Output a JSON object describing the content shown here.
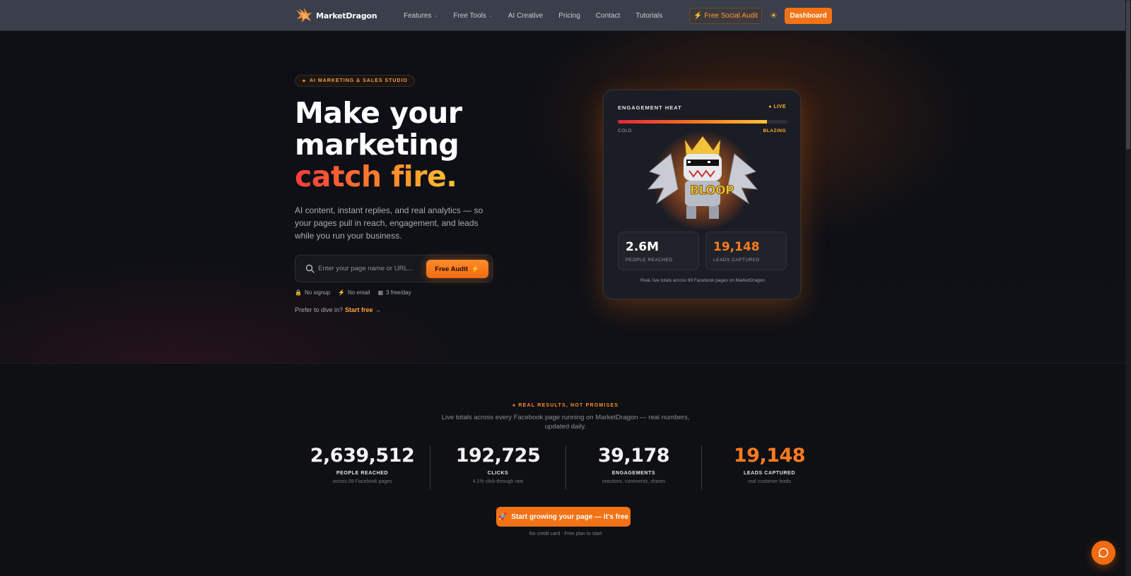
{
  "nav": {
    "brand": "MarketDragon",
    "links": [
      {
        "label": "Features",
        "dropdown": true
      },
      {
        "label": "Free Tools",
        "dropdown": true
      },
      {
        "label": "AI Creative",
        "dropdown": false
      },
      {
        "label": "Pricing",
        "dropdown": false
      },
      {
        "label": "Contact",
        "dropdown": false
      },
      {
        "label": "Tutorials",
        "dropdown": false
      }
    ],
    "audit_label": "Free Social Audit",
    "dashboard_label": "Dashboard"
  },
  "hero": {
    "tag": "AI MARKETING & SALES STUDIO",
    "headline_line1": "Make your",
    "headline_line2": "marketing",
    "headline_fire": "catch fire.",
    "subtext": "AI content, instant replies, and real analytics — so your pages pull in reach, engagement, and leads while you run your business.",
    "search_placeholder": "Enter your page name or URL...",
    "search_button": "Free Audit",
    "perks": [
      "No signup",
      "No email",
      "3 free/day"
    ],
    "prefer_text": "Prefer to dive in?",
    "prefer_link": "Start free →"
  },
  "card": {
    "title": "ENGAGEMENT HEAT",
    "live": "LIVE",
    "heat_level": 0.88,
    "cold_label": "COLD",
    "blazing_label": "BLAZING",
    "mascot_text": "BLOOP",
    "stats": [
      {
        "value": "2.6M",
        "label": "PEOPLE REACHED",
        "highlight": false
      },
      {
        "value": "19,148",
        "label": "LEADS CAPTURED",
        "highlight": true
      }
    ],
    "footer": "Real, live totals across 69 Facebook pages on MarketDragon"
  },
  "results": {
    "tag": "REAL RESULTS, NOT PROMISES",
    "subtitle": "Live totals across every Facebook page running on MarketDragon — real numbers, updated daily.",
    "stats": [
      {
        "value": "2,639,512",
        "label": "PEOPLE REACHED",
        "note": "across 69 Facebook pages",
        "highlight": false
      },
      {
        "value": "192,725",
        "label": "CLICKS",
        "note": "4.1% click-through rate",
        "highlight": false
      },
      {
        "value": "39,178",
        "label": "ENGAGEMENTS",
        "note": "reactions, comments, shares",
        "highlight": false
      },
      {
        "value": "19,148",
        "label": "LEADS CAPTURED",
        "note": "real customer leads",
        "highlight": true
      }
    ],
    "cta_label": "Start growing your page — it's free",
    "cta_note": "No credit card · Free plan to start"
  },
  "colors": {
    "accent": "#f27316",
    "accent_light": "#ff9a3c",
    "fire_gradient": [
      "#ff3b3b",
      "#ff8a2b",
      "#ffc533"
    ],
    "background": "#0f1014"
  },
  "icons": [
    "dragon-logo-icon",
    "bolt-icon",
    "sun-icon",
    "search-icon",
    "lock-icon",
    "grid-icon",
    "rocket-icon",
    "chat-icon"
  ]
}
